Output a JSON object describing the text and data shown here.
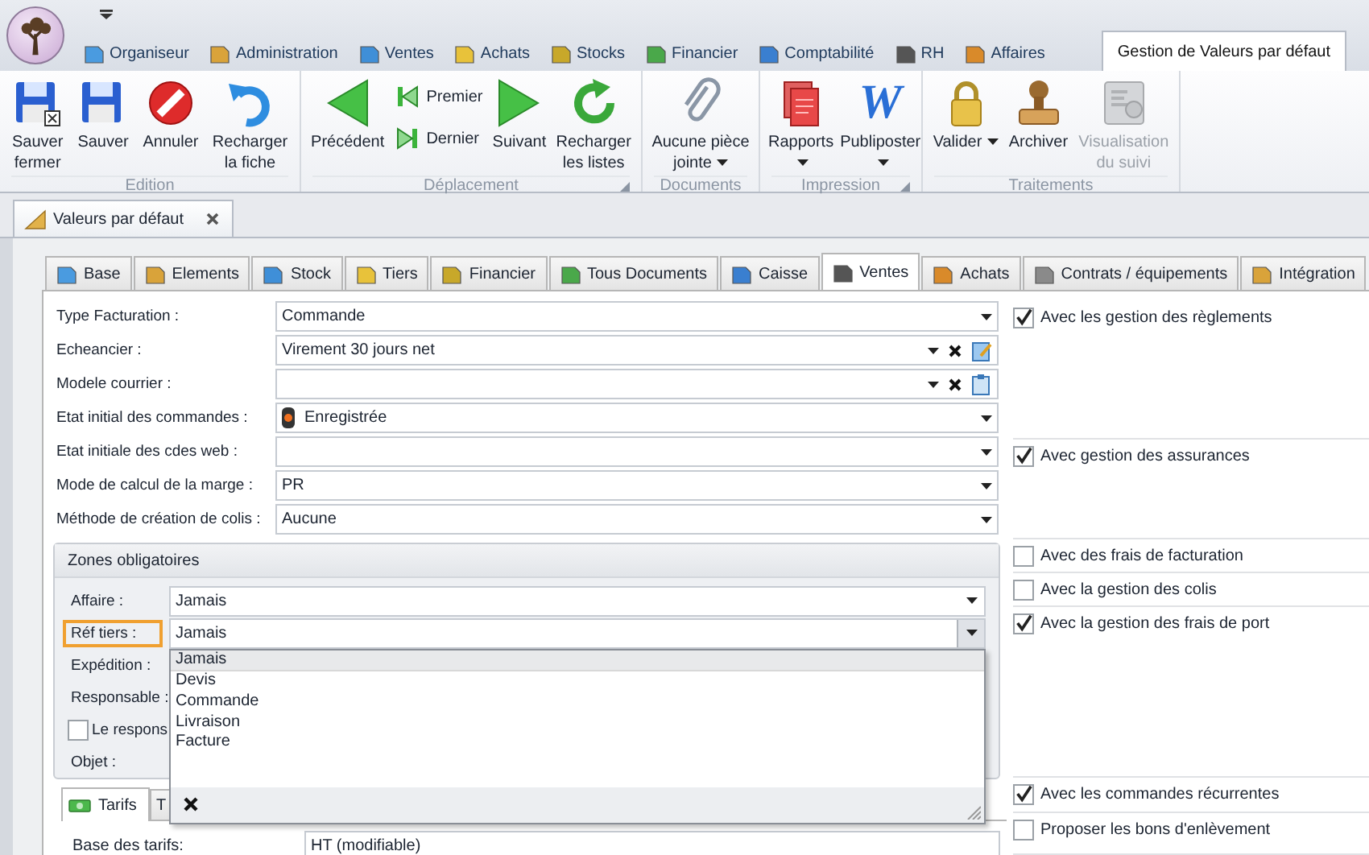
{
  "ribbon_tabs": [
    {
      "label": "Organiseur",
      "selected": false
    },
    {
      "label": "Administration",
      "selected": false
    },
    {
      "label": "Ventes",
      "selected": false
    },
    {
      "label": "Achats",
      "selected": false
    },
    {
      "label": "Stocks",
      "selected": false
    },
    {
      "label": "Financier",
      "selected": false
    },
    {
      "label": "Comptabilité",
      "selected": false
    },
    {
      "label": "RH",
      "selected": false
    },
    {
      "label": "Affaires",
      "selected": false
    },
    {
      "label": "Gestion de Valeurs par défaut",
      "selected": true
    }
  ],
  "ribbon_groups": [
    {
      "title": "Edition",
      "launcher": false,
      "items": [
        {
          "kind": "large",
          "label": "Sauver\nfermer",
          "dropdown": false,
          "disabled": false
        },
        {
          "kind": "large",
          "label": "Sauver",
          "dropdown": false,
          "disabled": false
        },
        {
          "kind": "large",
          "label": "Annuler",
          "dropdown": false,
          "disabled": false
        },
        {
          "kind": "large",
          "label": "Recharger\nla fiche",
          "dropdown": false,
          "disabled": false
        }
      ]
    },
    {
      "title": "Déplacement",
      "launcher": true,
      "items": [
        {
          "kind": "large",
          "label": "Précédent",
          "dropdown": false,
          "disabled": false
        },
        {
          "kind": "stack",
          "buttons": [
            {
              "label": "Premier",
              "disabled": false
            },
            {
              "label": "Dernier",
              "disabled": false
            }
          ]
        },
        {
          "kind": "large",
          "label": "Suivant",
          "dropdown": false,
          "disabled": false
        },
        {
          "kind": "large",
          "label": "Recharger\nles listes",
          "dropdown": false,
          "disabled": false
        }
      ]
    },
    {
      "title": "Documents",
      "launcher": false,
      "items": [
        {
          "kind": "large",
          "label": "Aucune pièce\njointe",
          "dropdown": true,
          "disabled": false
        }
      ]
    },
    {
      "title": "Impression",
      "launcher": true,
      "items": [
        {
          "kind": "large",
          "label": "Rapports",
          "dropdown": true,
          "disabled": false
        },
        {
          "kind": "large",
          "label": "Publiposter",
          "dropdown": true,
          "disabled": false,
          "glyph": "W"
        }
      ]
    },
    {
      "title": "Traitements",
      "launcher": false,
      "items": [
        {
          "kind": "large",
          "label": "Valider",
          "dropdown": true,
          "disabled": false
        },
        {
          "kind": "large",
          "label": "Archiver",
          "dropdown": false,
          "disabled": false
        },
        {
          "kind": "large",
          "label": "Visualisation\ndu suivi",
          "dropdown": false,
          "disabled": true
        }
      ]
    }
  ],
  "document_tab": {
    "label": "Valeurs par défaut"
  },
  "tabs": [
    {
      "label": "Base",
      "selected": false
    },
    {
      "label": "Elements",
      "selected": false
    },
    {
      "label": "Stock",
      "selected": false
    },
    {
      "label": "Tiers",
      "selected": false
    },
    {
      "label": "Financier",
      "selected": false
    },
    {
      "label": "Tous Documents",
      "selected": false
    },
    {
      "label": "Caisse",
      "selected": false
    },
    {
      "label": "Ventes",
      "selected": true
    },
    {
      "label": "Achats",
      "selected": false
    },
    {
      "label": "Contrats / équipements",
      "selected": false
    },
    {
      "label": "Intégration",
      "selected": false
    }
  ],
  "form": [
    {
      "kind": "select",
      "label": "Type Facturation :",
      "value": "Commande"
    },
    {
      "kind": "select-actions",
      "label": "Echeancier :",
      "value": "Virement 30 jours net"
    },
    {
      "kind": "select-actions",
      "label": "Modele courrier :"
    },
    {
      "kind": "status-select",
      "label": "Etat initial des commandes :",
      "value": "Enregistrée"
    },
    {
      "kind": "select",
      "label": "Etat initiale des cdes web :"
    },
    {
      "kind": "select",
      "label": "Mode de calcul de la marge :",
      "value": "PR"
    },
    {
      "kind": "select",
      "label": "Méthode de création de colis :",
      "value": "Aucune"
    }
  ],
  "zones": {
    "title": "Zones obligatoires",
    "rows": [
      {
        "kind": "select",
        "label": "Affaire :",
        "value": "Jamais",
        "highlighted": false,
        "open": false
      },
      {
        "kind": "select",
        "label": "Réf tiers :",
        "value": "Jamais",
        "highlighted": true,
        "open": true
      },
      {
        "kind": "label",
        "label": "Expédition :",
        "highlighted": false
      },
      {
        "kind": "label",
        "label": "Responsable :",
        "highlighted": false
      },
      {
        "kind": "checkbox",
        "label": "Le respons",
        "checked": false
      },
      {
        "kind": "label",
        "label": "Objet :",
        "highlighted": false
      }
    ]
  },
  "dropdown": {
    "options": [
      {
        "label": "Jamais",
        "selected": true
      },
      {
        "label": "Devis",
        "selected": false
      },
      {
        "label": "Commande",
        "selected": false
      },
      {
        "label": "Livraison",
        "selected": false
      },
      {
        "label": "Facture",
        "selected": false
      }
    ]
  },
  "bottom_tabs": [
    {
      "label": "Tarifs",
      "selected": true
    },
    {
      "label": "T",
      "selected": false
    }
  ],
  "tarifs": {
    "label": "Base des tarifs:",
    "value": "HT (modifiable)"
  },
  "options": [
    {
      "items": [
        {
          "label": "Avec les gestion des règlements",
          "checked": true
        }
      ]
    },
    {
      "items": [
        {
          "label": "Avec gestion des assurances",
          "checked": true
        }
      ]
    },
    {
      "items": [
        {
          "label": "Avec des frais de facturation",
          "checked": false
        }
      ]
    },
    {
      "items": [
        {
          "label": "Avec la gestion des colis",
          "checked": false
        }
      ]
    },
    {
      "items": [
        {
          "label": "Avec la gestion des frais de port",
          "checked": true
        }
      ]
    },
    {
      "items": [
        {
          "label": "Avec les commandes récurrentes",
          "checked": true
        }
      ]
    },
    {
      "items": [
        {
          "label": "Proposer les bons d'enlèvement",
          "checked": false
        }
      ]
    }
  ]
}
